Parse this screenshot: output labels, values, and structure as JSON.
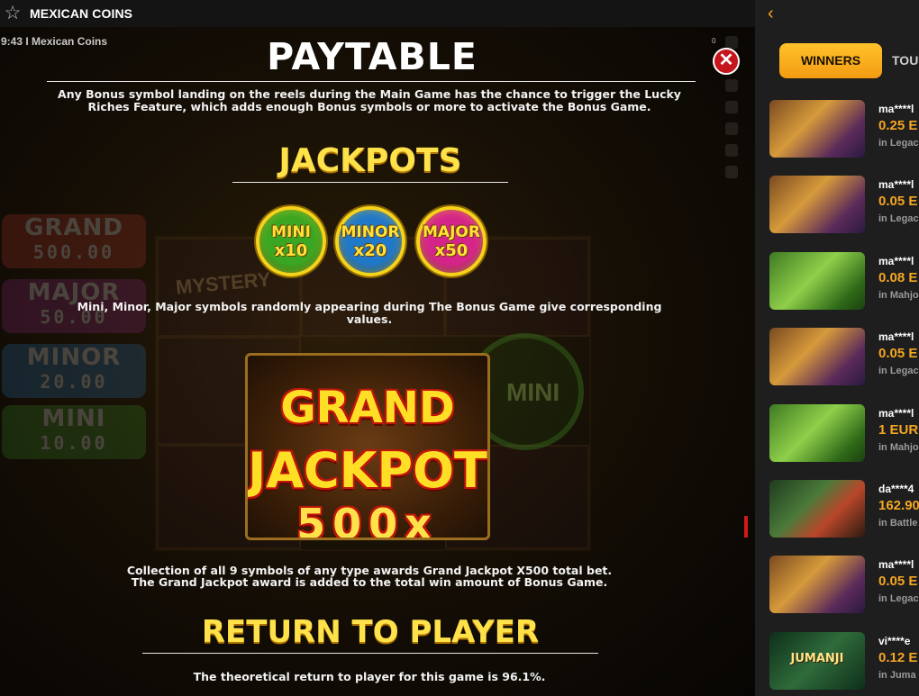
{
  "topbar": {
    "favorite_icon": "star-outline-icon",
    "game_name": "MEXICAN COINS"
  },
  "game": {
    "time_title": "9:43 I Mexican Coins",
    "counter": "0",
    "background": {
      "jackpots": [
        {
          "name": "GRAND",
          "value": "500.00",
          "color": "#c0392b"
        },
        {
          "name": "MAJOR",
          "value": "50.00",
          "color": "#9b2a8a"
        },
        {
          "name": "MINOR",
          "value": "20.00",
          "color": "#2a7abf"
        },
        {
          "name": "MINI",
          "value": "10.00",
          "color": "#3d9a2a"
        }
      ],
      "mystery_label": "MYSTERY",
      "mini_label": "MINI"
    }
  },
  "paytable": {
    "title": "PAYTABLE",
    "bonus_text": "Any Bonus symbol landing on the reels during the Main Game has the chance to trigger the Lucky Riches Feature, which adds enough Bonus symbols or more to activate the Bonus Game.",
    "jackpots_title": "JACKPOTS",
    "coins": [
      {
        "name": "MINI",
        "multiplier": "x10",
        "color": "#3aa622"
      },
      {
        "name": "MINOR",
        "multiplier": "x20",
        "color": "#1f78c8"
      },
      {
        "name": "MAJOR",
        "multiplier": "x50",
        "color": "#d4248a"
      }
    ],
    "coins_text": "Mini, Minor, Major symbols randomly appearing during The Bonus Game give corresponding values.",
    "grand": {
      "line1": "GRAND",
      "line2": "JACKPOT",
      "line3": "500x"
    },
    "grand_text_1": "Collection of all 9 symbols of any type awards Grand Jackpot X500 total bet.",
    "grand_text_2": "The Grand Jackpot award is added to the total win amount of Bonus Game.",
    "rtp_title": "RETURN TO PLAYER",
    "rtp_text": "The theoretical return to player for this game is 96.1%.",
    "close_icon": "close-icon"
  },
  "panel": {
    "back_icon": "chevron-left-icon",
    "tab_active": "WINNERS",
    "tab_other": "TOU",
    "winners": [
      {
        "user": "ma****l",
        "amount": "0.25 E",
        "game": "in Legac",
        "thumb": "legacy",
        "thumb_label": ""
      },
      {
        "user": "ma****l",
        "amount": "0.05 E",
        "game": "in Legac",
        "thumb": "legacy",
        "thumb_label": ""
      },
      {
        "user": "ma****l",
        "amount": "0.08 E",
        "game": "in Mahjo",
        "thumb": "mahjong",
        "thumb_label": ""
      },
      {
        "user": "ma****l",
        "amount": "0.05 E",
        "game": "in Legac",
        "thumb": "legacy",
        "thumb_label": ""
      },
      {
        "user": "ma****l",
        "amount": "1 EUR",
        "game": "in Mahjo",
        "thumb": "mahjong",
        "thumb_label": ""
      },
      {
        "user": "da****4",
        "amount": "162.90",
        "game": "in Battle",
        "thumb": "battle",
        "thumb_label": ""
      },
      {
        "user": "ma****l",
        "amount": "0.05 E",
        "game": "in Legac",
        "thumb": "legacy",
        "thumb_label": ""
      },
      {
        "user": "vi****e",
        "amount": "0.12 E",
        "game": "in Juma",
        "thumb": "jumanji",
        "thumb_label": "JUMANJI"
      }
    ]
  }
}
